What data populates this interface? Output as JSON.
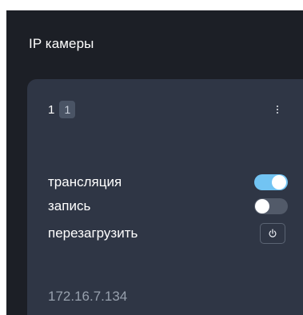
{
  "page": {
    "title": "IP камеры"
  },
  "camera": {
    "name": "1",
    "badge": "1",
    "menu_icon": "more-vertical-icon",
    "controls": [
      {
        "label": "трансляция",
        "type": "toggle",
        "state": "on"
      },
      {
        "label": "запись",
        "type": "toggle",
        "state": "off"
      },
      {
        "label": "перезагрузить",
        "type": "button",
        "icon": "power-icon"
      }
    ],
    "ip": "172.16.7.134"
  },
  "colors": {
    "page_background": "#1c1f26",
    "card_background": "#2f3645",
    "toggle_on": "#72c4f3",
    "toggle_off": "#525a69",
    "badge_background": "#4a5465",
    "ip_text": "#97a0ad"
  }
}
